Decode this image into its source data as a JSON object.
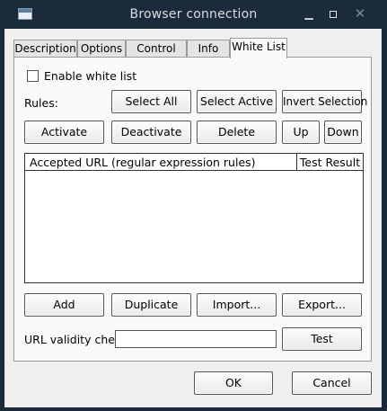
{
  "window": {
    "title": "Browser connection"
  },
  "tabs": [
    "Description",
    "Options",
    "Control Bar",
    "Info Bar",
    "White List"
  ],
  "white_list": {
    "enable_label": "Enable white list",
    "rules_label": "Rules:",
    "select_all": "Select All",
    "select_active": "Select Active",
    "invert_selection": "Invert Selection",
    "activate": "Activate",
    "deactivate": "Deactivate",
    "delete": "Delete",
    "up": "Up",
    "down": "Down",
    "columns": [
      "Accepted URL (regular expression rules)",
      "Test Result"
    ],
    "add": "Add",
    "duplicate": "Duplicate",
    "import": "Import...",
    "export": "Export...",
    "url_check_label": "URL validity check",
    "url_check_value": "",
    "test": "Test"
  },
  "dialog": {
    "ok": "OK",
    "cancel": "Cancel"
  }
}
